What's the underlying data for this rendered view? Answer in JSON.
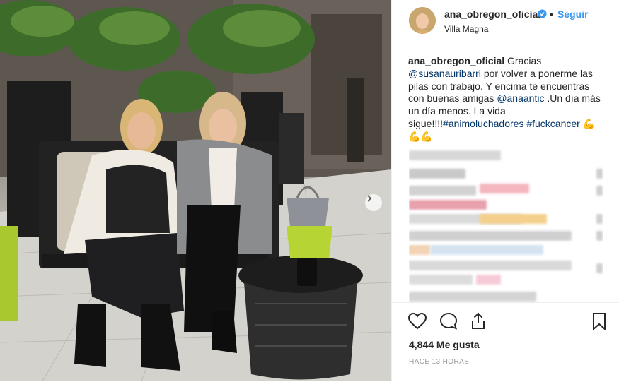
{
  "post": {
    "username": "ana_obregon_oficial",
    "follow_label": "Seguir",
    "separator": "•",
    "location": "Villa Magna",
    "caption": {
      "author": "ana_obregon_oficial",
      "text_1": "Gracias",
      "mention_1": "@susanauribarri",
      "text_2": "por volver a ponerme las pilas con trabajo. Y encima te encuentras con buenas amigas",
      "mention_2": "@anaantic",
      "text_3": ".Un día más un día menos. La vida sigue!!!!",
      "hashtag_1": "#animoluchadores",
      "hashtag_2": "#fuckcancer",
      "emoji_1": "💪",
      "emoji_2": "💪💪"
    },
    "likes": "4,844 Me gusta",
    "time": "HACE 13 HORAS"
  },
  "icons": {
    "like": "heart-icon",
    "comment": "comment-icon",
    "share": "share-icon",
    "save": "bookmark-icon",
    "verified": "verified-badge-icon",
    "next": "chevron-right-icon"
  },
  "colors": {
    "link": "#003569",
    "follow": "#3897f0",
    "verified": "#3897f0"
  }
}
